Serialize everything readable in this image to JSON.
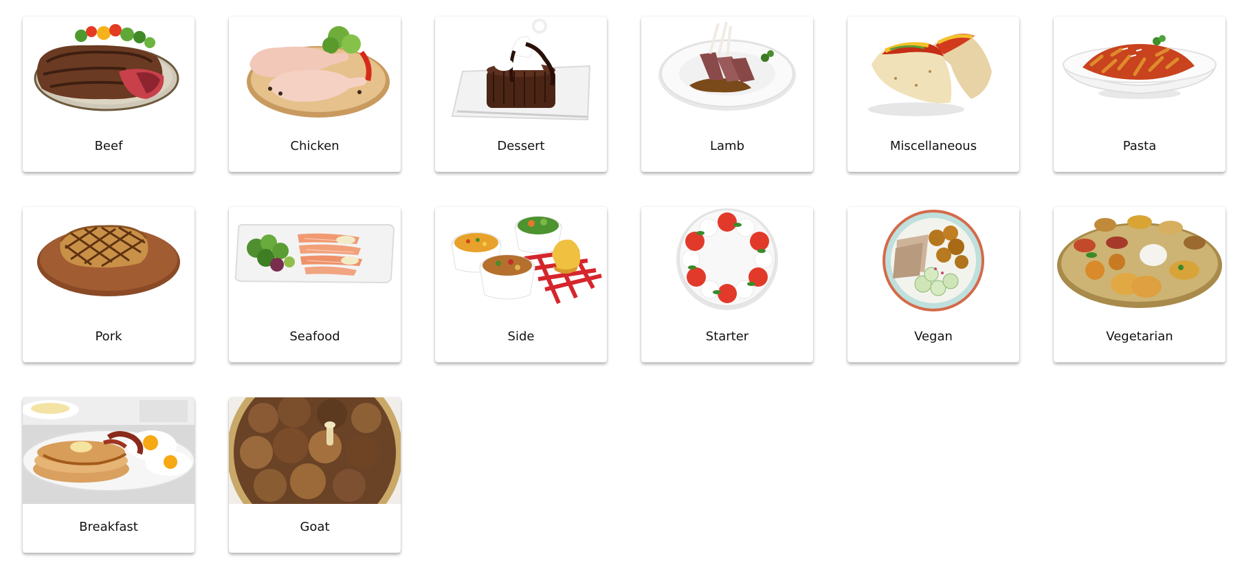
{
  "categories": [
    {
      "label": "Beef",
      "image": "beef"
    },
    {
      "label": "Chicken",
      "image": "chicken"
    },
    {
      "label": "Dessert",
      "image": "dessert"
    },
    {
      "label": "Lamb",
      "image": "lamb"
    },
    {
      "label": "Miscellaneous",
      "image": "miscellaneous"
    },
    {
      "label": "Pasta",
      "image": "pasta"
    },
    {
      "label": "Pork",
      "image": "pork"
    },
    {
      "label": "Seafood",
      "image": "seafood"
    },
    {
      "label": "Side",
      "image": "side"
    },
    {
      "label": "Starter",
      "image": "starter"
    },
    {
      "label": "Vegan",
      "image": "vegan"
    },
    {
      "label": "Vegetarian",
      "image": "vegetarian"
    },
    {
      "label": "Breakfast",
      "image": "breakfast"
    },
    {
      "label": "Goat",
      "image": "goat"
    }
  ]
}
